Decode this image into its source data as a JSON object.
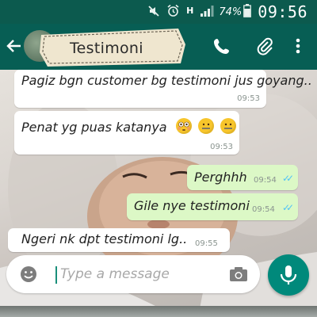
{
  "status_bar": {
    "network": "H",
    "battery_pct": "74%",
    "time": "09:56"
  },
  "header": {
    "label_title": "Testimoni"
  },
  "messages": [
    {
      "text": "Pagiz bgn customer bg testimoni jus goyang..",
      "time": "09:53",
      "direction": "incoming"
    },
    {
      "text": "Penat yg puas katanya",
      "time": "09:53",
      "direction": "incoming",
      "emojis": [
        "flushed-face",
        "zipper-mouth-face",
        "zipper-mouth-face"
      ]
    },
    {
      "text": "Perghhh",
      "time": "09:54",
      "direction": "outgoing",
      "status": "read"
    },
    {
      "text": "Gile nye testimoni",
      "time": "09:54",
      "direction": "outgoing",
      "status": "read"
    },
    {
      "text": "Ngeri nk dpt testimoni lg..",
      "time": "09:55",
      "direction": "incoming"
    }
  ],
  "composer": {
    "placeholder": "Type a message"
  },
  "icons": [
    "mute-icon",
    "alarm-icon",
    "signal-icon",
    "battery-icon",
    "back-arrow-icon",
    "call-icon",
    "attach-icon",
    "more-vert-icon",
    "emoji-icon",
    "camera-icon",
    "mic-icon"
  ],
  "colors": {
    "toolbar": "#075e54",
    "status_bar": "#0c5a4e",
    "outgoing_bubble": "#dcf8c6",
    "incoming_bubble": "#ffffff",
    "mic_button": "#00897b",
    "read_ticks": "#4fc3f7"
  }
}
